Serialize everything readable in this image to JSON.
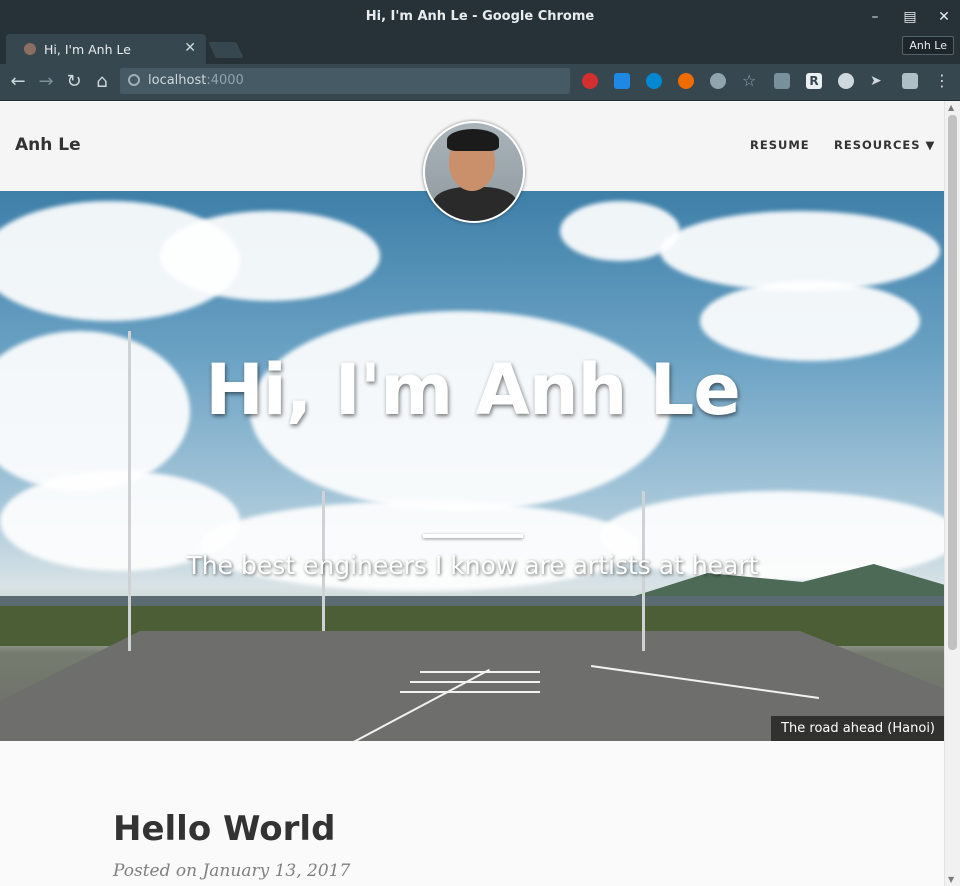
{
  "window": {
    "title": "Hi, I'm Anh Le - Google Chrome",
    "profile": "Anh Le"
  },
  "tab": {
    "title": "Hi, I'm Anh Le"
  },
  "toolbar": {
    "url_host": "localhost",
    "url_port": ":4000",
    "extensions": [
      "ublock-icon",
      "extension-blue-icon",
      "refresh-extension-icon",
      "extension-orange-icon",
      "extension-circle-icon",
      "star-icon",
      "extension-gray-icon",
      "r-extension-icon",
      "lightbulb-extension-icon",
      "pointer-extension-icon",
      "extension-pattern-icon",
      "menu-icon"
    ]
  },
  "site": {
    "brand": "Anh Le",
    "nav": {
      "resume": "RESUME",
      "resources": "RESOURCES ▼"
    }
  },
  "hero": {
    "title": "Hi, I'm Anh Le",
    "subtitle": "The best engineers I know are artists at heart",
    "caption": "The road ahead (Hanoi)"
  },
  "post": {
    "title": "Hello World",
    "meta": "Posted on January 13, 2017"
  },
  "colors": {
    "chrome_dark": "#263238",
    "toolbar": "#37474f",
    "page_bg": "#fafafa",
    "text": "#333333"
  }
}
